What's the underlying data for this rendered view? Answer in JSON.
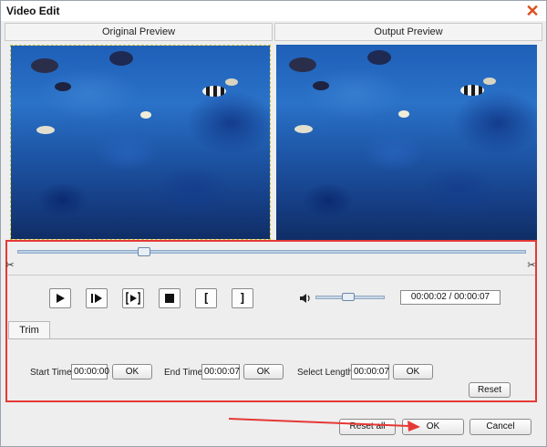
{
  "window": {
    "title": "Video Edit"
  },
  "preview": {
    "original_label": "Original Preview",
    "output_label": "Output Preview"
  },
  "player": {
    "buttons": [
      {
        "name": "play-button",
        "icon": "play-icon"
      },
      {
        "name": "next-frame-button",
        "icon": "next-frame-icon"
      },
      {
        "name": "play-selection-button",
        "icon": "play-selection-icon"
      },
      {
        "name": "stop-button",
        "icon": "stop-icon"
      },
      {
        "name": "set-start-button",
        "icon": "bracket-open-icon",
        "glyph": "["
      },
      {
        "name": "set-end-button",
        "icon": "bracket-close-icon",
        "glyph": "]"
      }
    ],
    "volume_level": 0.45,
    "timeline_position": 0.25,
    "time_display": "00:00:02 / 00:00:07"
  },
  "trim": {
    "tab_label": "Trim",
    "start_label": "Start Time",
    "start_value": "00:00:00",
    "end_label": "End Time",
    "end_value": "00:00:07",
    "length_label": "Select Length",
    "length_value": "00:00:07",
    "ok_label": "OK",
    "reset_label": "Reset"
  },
  "footer": {
    "reset_all_label": "Reset all",
    "ok_label": "OK",
    "cancel_label": "Cancel"
  },
  "colors": {
    "highlight": "#e53935",
    "close": "#d9501e"
  }
}
